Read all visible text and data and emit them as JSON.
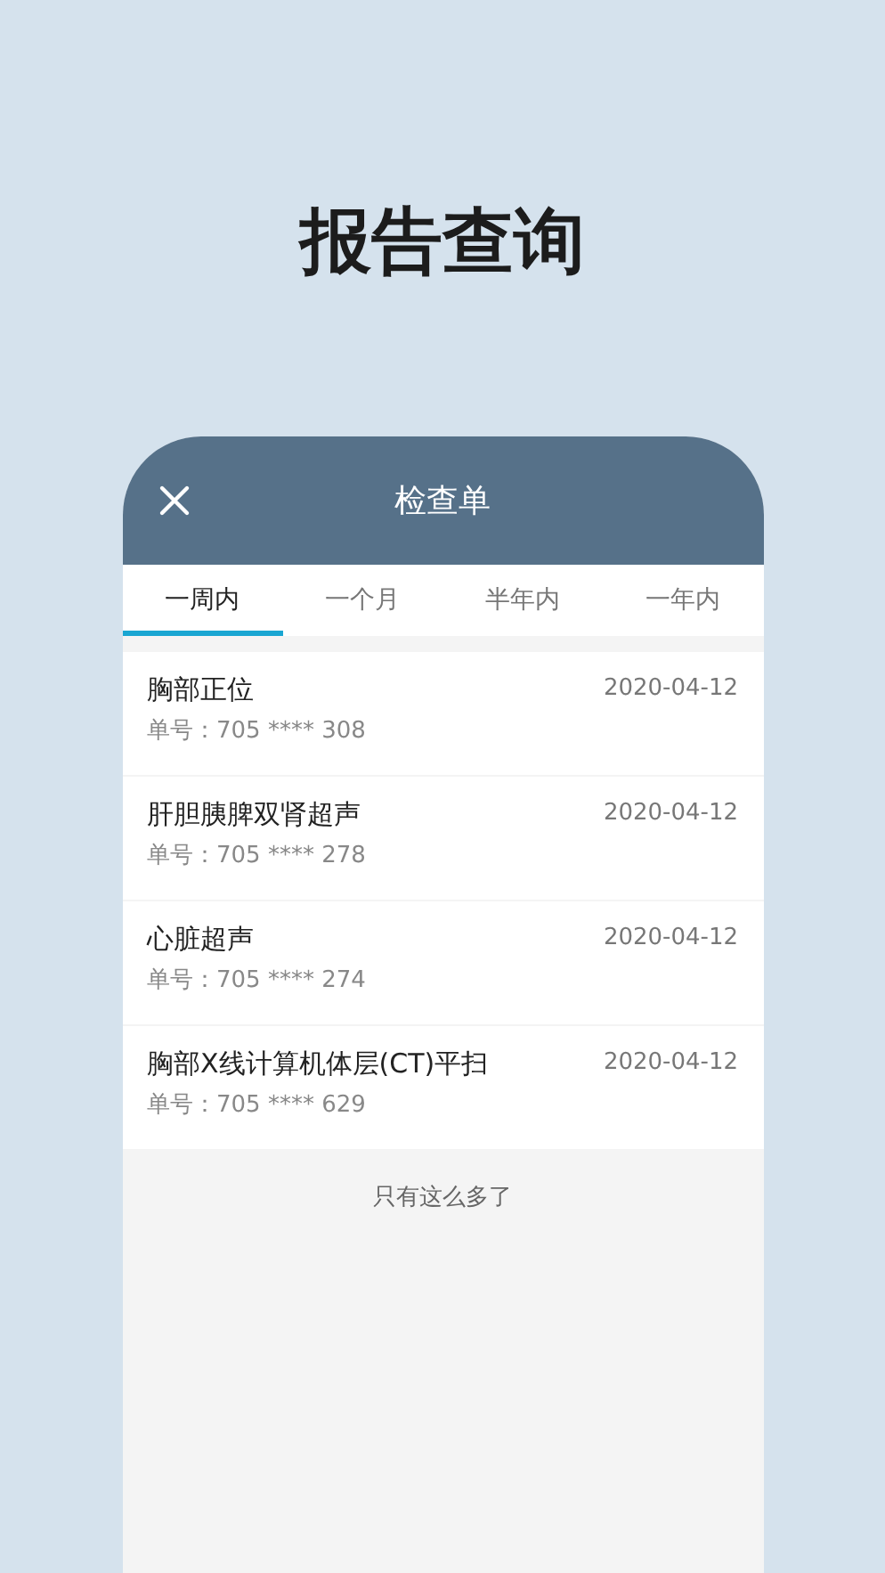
{
  "headline": "报告查询",
  "header": {
    "title": "检查单"
  },
  "tabs": [
    {
      "label": "一周内",
      "selected": true
    },
    {
      "label": "一个月",
      "selected": false
    },
    {
      "label": "半年内",
      "selected": false
    },
    {
      "label": "一年内",
      "selected": false
    }
  ],
  "items": [
    {
      "name": "胸部正位",
      "number": "单号：705 **** 308",
      "date": "2020-04-12"
    },
    {
      "name": "肝胆胰脾双肾超声",
      "number": "单号：705 **** 278",
      "date": "2020-04-12"
    },
    {
      "name": "心脏超声",
      "number": "单号：705 **** 274",
      "date": "2020-04-12"
    },
    {
      "name": "胸部X线计算机体层(CT)平扫",
      "number": "单号：705 **** 629",
      "date": "2020-04-12"
    }
  ],
  "footer": "只有这么多了"
}
